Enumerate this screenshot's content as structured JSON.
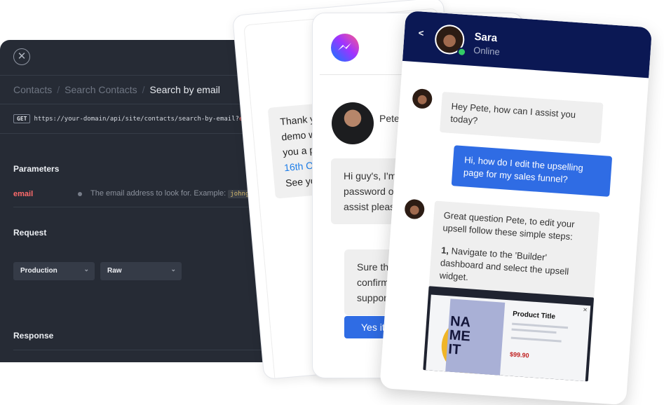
{
  "api_panel": {
    "close_icon": "close-icon",
    "breadcrumb": [
      "Contacts",
      "Search Contacts",
      "Search by email"
    ],
    "endpoint": {
      "method": "GET",
      "url": "https://your-domain/api/site/contacts/search-by-email?",
      "param_fragment": "email"
    },
    "parameters_title": "Parameters",
    "param": {
      "name": "email",
      "description": "The email address to look for. Example:",
      "example": "johng"
    },
    "request_title": "Request",
    "environment_select": "Production",
    "format_select": "Raw",
    "response_title": "Response",
    "colors": {
      "background": "#262b35",
      "param": "#ff6b6b"
    }
  },
  "back_card": {
    "bubble_lines": [
      "Thank yo",
      "demo w",
      "you a po",
      "16th Oc",
      "See you"
    ]
  },
  "messenger_card": {
    "logo_icon": "messenger-icon",
    "contact_name": "Pete R",
    "message_1": [
      "Hi guy's, I'm w",
      "password or",
      "assist please"
    ],
    "message_2": [
      "Sure that",
      "confirm",
      "support@"
    ],
    "button_label": "Yes it",
    "colors": {
      "button": "#2f6ce4"
    }
  },
  "chat_card": {
    "back_label": "<",
    "agent_name": "Sara",
    "agent_status": "Online",
    "msg_agent_1": "Hey Pete, how can I assist you today?",
    "msg_user_1": "Hi, how do I edit the upselling page for my sales funnel?",
    "msg_agent_2": "Great question Pete, to edit your upsell follow these simple steps:",
    "step_number": "1,",
    "step_text": "Navigate to the 'Builder' dashboard and select the upsell widget.",
    "screenshot": {
      "book_text": [
        "NA",
        "ME",
        "IT"
      ],
      "product_title": "Product Title",
      "price": "$99.90"
    },
    "colors": {
      "header": "#0b1854",
      "user_bubble": "#2f6ce4",
      "online": "#33cc66"
    }
  }
}
